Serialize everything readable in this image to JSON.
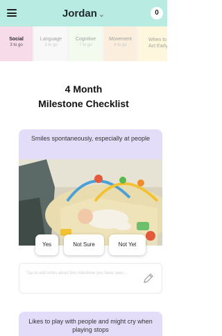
{
  "header": {
    "child_name": "Jordan",
    "chevron": "⌄",
    "badge_count": "0",
    "menu_icon": "hamburger-menu-icon",
    "background": "#b8ece2"
  },
  "tabs": [
    {
      "label": "Social",
      "sub": "3 to go",
      "active": true
    },
    {
      "label": "Language",
      "sub": "3 to go",
      "active": false
    },
    {
      "label": "Cognitive",
      "sub": "7 to go",
      "active": false
    },
    {
      "label": "Movement",
      "sub": "6 to go",
      "active": false
    },
    {
      "label": "When to Act Early",
      "sub": "",
      "active": false
    }
  ],
  "title": {
    "line1": "4 Month",
    "line2": "Milestone Checklist"
  },
  "questions": [
    {
      "text": "Smiles spontaneously, especially at people"
    },
    {
      "text": "Likes to play with people and might cry when playing stops"
    }
  ],
  "answers": {
    "yes": "Yes",
    "not_sure": "Not Sure",
    "not_yet": "Not Yet"
  },
  "notes": {
    "placeholder": "Tap to add notes about this milestone you have seen..."
  },
  "colors": {
    "question_card": "#e4ddf9",
    "active_tab": "#f7dbe8"
  }
}
